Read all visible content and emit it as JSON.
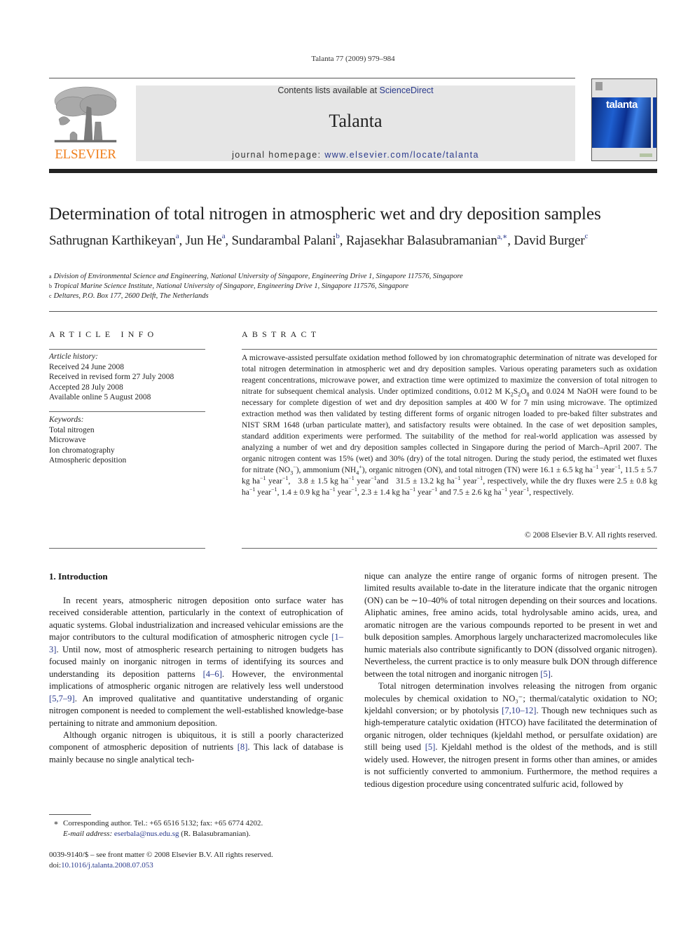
{
  "running_head": "Talanta 77 (2009) 979–984",
  "masthead": {
    "contents_prefix": "Contents lists available at ",
    "contents_link": "ScienceDirect",
    "journal_name": "Talanta",
    "homepage_prefix": "journal homepage: ",
    "homepage_url": "www.elsevier.com/locate/talanta",
    "publisher_logo_text": "ELSEVIER",
    "cover_title": "talanta",
    "brand_color": "#f07f1c",
    "link_color": "#2a3a8c"
  },
  "article": {
    "title": "Determination of total nitrogen in atmospheric wet and dry deposition samples",
    "authors": [
      {
        "name": "Sathrugnan Karthikeyan",
        "mark": "a"
      },
      {
        "name": "Jun He",
        "mark": "a"
      },
      {
        "name": "Sundarambal Palani",
        "mark": "b"
      },
      {
        "name": "Rajasekhar Balasubramanian",
        "mark": "a,∗"
      },
      {
        "name": "David Burger",
        "mark": "c"
      }
    ],
    "affiliations": [
      {
        "mark": "a",
        "text": "Division of Environmental Science and Engineering, National University of Singapore, Engineering Drive 1, Singapore 117576, Singapore"
      },
      {
        "mark": "b",
        "text": "Tropical Marine Science Institute, National University of Singapore, Engineering Drive 1, Singapore 117576, Singapore"
      },
      {
        "mark": "c",
        "text": "Deltares, P.O. Box 177, 2600 Delft, The Netherlands"
      }
    ]
  },
  "article_info": {
    "heading": "ARTICLE INFO",
    "history_label": "Article history:",
    "history": [
      "Received 24 June 2008",
      "Received in revised form 27 July 2008",
      "Accepted 28 July 2008",
      "Available online 5 August 2008"
    ],
    "keywords_label": "Keywords:",
    "keywords": [
      "Total nitrogen",
      "Microwave",
      "Ion chromatography",
      "Atmospheric deposition"
    ]
  },
  "abstract": {
    "heading": "ABSTRACT",
    "p1": "A microwave-assisted persulfate oxidation method followed by ion chromatographic determination of nitrate was developed for total nitrogen determination in atmospheric wet and dry deposition samples. Various operating parameters such as oxidation reagent concentrations, microwave power, and extraction time were optimized to maximize the conversion of total nitrogen to nitrate for subsequent chemical analysis. Under optimized conditions, 0.012 M K",
    "p1_sub1": "2",
    "p1_s": "S",
    "p1_sub2": "2",
    "p1_o": "O",
    "p1_sub3": "8",
    "p2": " and 0.024 M NaOH were found to be necessary for complete digestion of wet and dry deposition samples at 400 W for 7 min using microwave. The optimized extraction method was then validated by testing different forms of organic nitrogen loaded to pre-baked filter substrates and NIST SRM 1648 (urban particulate matter), and satisfactory results were obtained. In the case of wet deposition samples, standard addition experiments were performed. The suitability of the method for real-world application was assessed by analyzing a number of wet and dry deposition samples collected in Singapore during the period of March–April 2007. The organic nitrogen content was 15% (wet) and 30% (dry) of the total nitrogen. During the study period, the estimated wet fluxes for nitrate (NO",
    "no3_sub": "3",
    "no3_sup": "−",
    "p3": "), ammonium (NH",
    "nh4_sub": "4",
    "nh4_sup": "+",
    "p4": "), organic nitrogen (ON), and total nitrogen (TN) were 16.1 ± 6.5 kg ha",
    "unit_sup": "−1",
    "wet_fluxes": [
      "16.1 ± 6.5",
      "11.5 ± 5.7",
      "3.8 ± 1.5",
      "31.5 ± 13.2"
    ],
    "dry_fluxes": [
      "2.5 ± 0.8",
      "1.4 ± 0.9",
      "2.3 ± 1.4",
      "7.5 ± 2.6"
    ],
    "unit_kg": " kg ha",
    "unit_year": " year",
    "copyright": "© 2008 Elsevier B.V. All rights reserved."
  },
  "introduction": {
    "heading": "1.  Introduction",
    "left_p1": [
      {
        "t": "In recent years, atmospheric nitrogen deposition onto surface water has received considerable attention, particularly in the context of eutrophication of aquatic systems. Global industrialization and increased vehicular emissions are the major contributors to the cultural modification of atmospheric nitrogen cycle "
      },
      {
        "c": "[1–3]"
      },
      {
        "t": ". Until now, most of atmospheric research pertaining to nitrogen budgets has focused mainly on inorganic nitrogen in terms of identifying its sources and understanding its deposition patterns "
      },
      {
        "c": "[4–6]"
      },
      {
        "t": ". However, the environmental implications of atmospheric organic nitrogen are relatively less well understood "
      },
      {
        "c": "[5,7–9]"
      },
      {
        "t": ". An improved qualitative and quantitative understanding of organic nitrogen component is needed to complement the well-established knowledge-base pertaining to nitrate and ammonium deposition."
      }
    ],
    "left_p2": [
      {
        "t": "Although organic nitrogen is ubiquitous, it is still a poorly characterized component of atmospheric deposition of nutrients "
      },
      {
        "c": "[8]"
      },
      {
        "t": ". This lack of database is mainly because no single analytical tech-"
      }
    ],
    "right_p1": [
      {
        "t": "nique can analyze the entire range of organic forms of nitrogen present. The limited results available to-date in the literature indicate that the organic nitrogen (ON) can be ∼10–40% of total nitrogen depending on their sources and locations. Aliphatic amines, free amino acids, total hydrolysable amino acids, urea, and aromatic nitrogen are the various compounds reported to be present in wet and bulk deposition samples. Amorphous largely uncharacterized macromolecules like humic materials also contribute significantly to DON (dissolved organic nitrogen). Nevertheless, the current practice is to only measure bulk DON through difference between the total nitrogen and inorganic nitrogen "
      },
      {
        "c": "[5]"
      },
      {
        "t": "."
      }
    ],
    "right_p2": [
      {
        "t": "Total nitrogen determination involves releasing the nitrogen from organic molecules by chemical oxidation to NO₃⁻; thermal/catalytic oxidation to NO; kjeldahl conversion; or by photolysis "
      },
      {
        "c": "[7,10–12]"
      },
      {
        "t": ". Though new techniques such as high-temperature catalytic oxidation (HTCO) have facilitated the determination of organic nitrogen, older techniques (kjeldahl method, or persulfate oxidation) are still being used "
      },
      {
        "c": "[5]"
      },
      {
        "t": ". Kjeldahl method is the oldest of the methods, and is still widely used. However, the nitrogen present in forms other than amines, or amides is not sufficiently converted to ammonium. Furthermore, the method requires a tedious digestion procedure using concentrated sulfuric acid, followed by"
      }
    ]
  },
  "footnote": {
    "star": "∗",
    "corresponding": "Corresponding author. Tel.: +65 6516 5132; fax: +65 6774 4202.",
    "email_label": "E-mail address: ",
    "email": "eserbala@nus.edu.sg",
    "email_suffix": " (R. Balasubramanian)."
  },
  "issn": {
    "line1": "0039-9140/$ – see front matter © 2008 Elsevier B.V. All rights reserved.",
    "doi_label": "doi:",
    "doi": "10.1016/j.talanta.2008.07.053"
  }
}
